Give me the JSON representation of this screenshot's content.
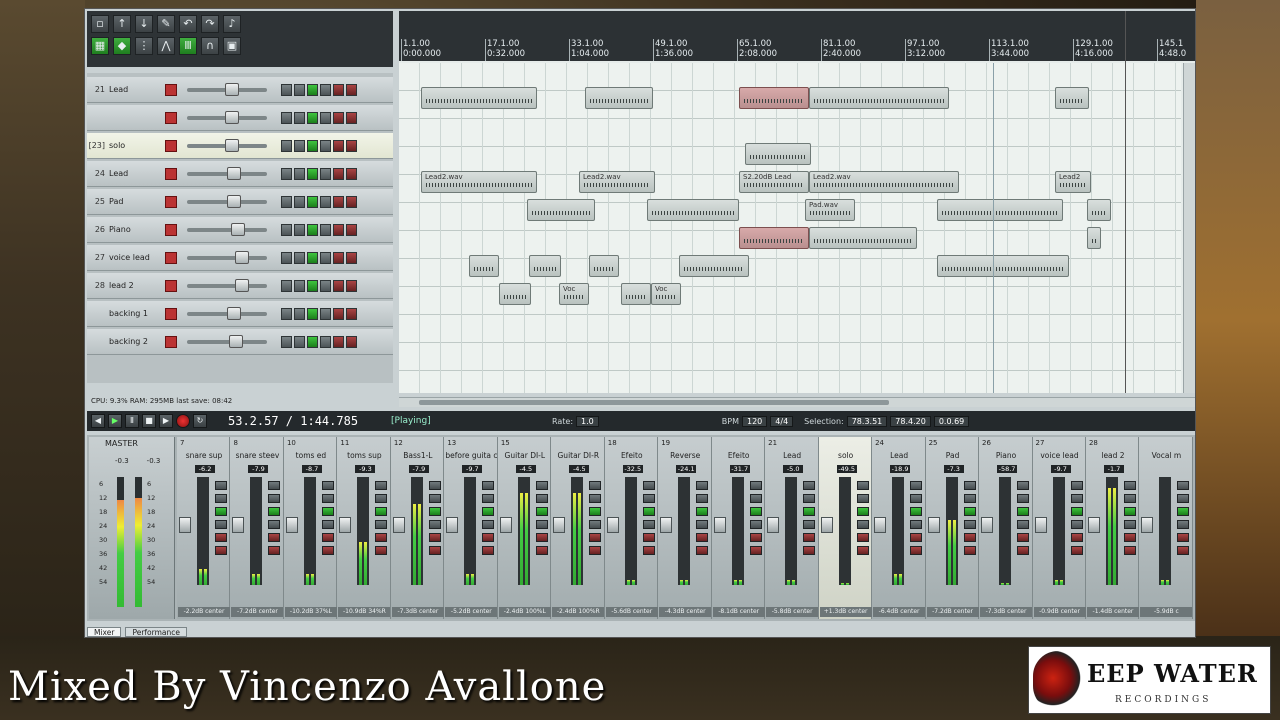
{
  "toolbar": {
    "row1": [
      "new-file",
      "open",
      "save",
      "render",
      "undo",
      "redo",
      "metronome"
    ],
    "row2": [
      "grid",
      "snap",
      "mixer",
      "trim",
      "midi",
      "loop",
      "lock"
    ]
  },
  "tracks": [
    {
      "num": "21",
      "name": "Lead"
    },
    {
      "num": "",
      "name": ""
    },
    {
      "num": "[23]",
      "name": "solo"
    },
    {
      "num": "24",
      "name": "Lead"
    },
    {
      "num": "25",
      "name": "Pad"
    },
    {
      "num": "26",
      "name": "Piano"
    },
    {
      "num": "27",
      "name": "voice lead"
    },
    {
      "num": "28",
      "name": "lead 2"
    },
    {
      "num": "",
      "name": "backing 1"
    },
    {
      "num": "",
      "name": "backing 2"
    }
  ],
  "status": "CPU: 9.3%  RAM: 295MB  last save: 08:42",
  "ruler": {
    "marks": [
      {
        "bar": "1.1.00",
        "time": "0:00.000"
      },
      {
        "bar": "17.1.00",
        "time": "0:32.000"
      },
      {
        "bar": "33.1.00",
        "time": "1:04.000"
      },
      {
        "bar": "49.1.00",
        "time": "1:36.000"
      },
      {
        "bar": "65.1.00",
        "time": "2:08.000"
      },
      {
        "bar": "81.1.00",
        "time": "2:40.000"
      },
      {
        "bar": "97.1.00",
        "time": "3:12.000"
      },
      {
        "bar": "113.1.00",
        "time": "3:44.000"
      },
      {
        "bar": "129.1.00",
        "time": "4:16.000"
      },
      {
        "bar": "145.1",
        "time": "4:48.0"
      }
    ]
  },
  "items": [
    {
      "label": "Lead2.wav",
      "lane": 3
    },
    {
      "label": "Lead2.wav",
      "lane": 3
    },
    {
      "label": "S2.20dB Lead",
      "lane": 3
    },
    {
      "label": "Lead2.wav",
      "lane": 3
    },
    {
      "label": "Lead2",
      "lane": 3
    },
    {
      "label": "Pad.wav",
      "lane": 4
    },
    {
      "label": "Voc",
      "lane": 7
    },
    {
      "label": "Voc",
      "lane": 7
    }
  ],
  "transport": {
    "time": "53.2.57 / 1:44.785",
    "state": "[Playing]",
    "rate_label": "Rate:",
    "rate": "1.0",
    "bpm_label": "BPM",
    "bpm": "120",
    "sig": "4/4",
    "selection_label": "Selection:",
    "sel_start": "78.3.51",
    "sel_end": "78.4.20",
    "sel_len": "0.0.69"
  },
  "master": {
    "label": "MASTER",
    "left_db": "-0.3",
    "right_db": "-0.3",
    "scale": [
      "6",
      "12",
      "18",
      "24",
      "30",
      "36",
      "42",
      "54"
    ],
    "level_left": 0.82,
    "level_right": 0.84
  },
  "channels": [
    {
      "num": "7",
      "name": "snare sup",
      "db": "-6.2",
      "pan": "-2.2dB center",
      "level": 0.15
    },
    {
      "num": "8",
      "name": "snare steev",
      "db": "-7.9",
      "pan": "-7.2dB center",
      "level": 0.1
    },
    {
      "num": "10",
      "name": "toms ed",
      "db": "-8.7",
      "pan": "-10.2dB 37%L",
      "level": 0.1
    },
    {
      "num": "11",
      "name": "toms sup",
      "db": "-9.3",
      "pan": "-10.9dB 34%R",
      "level": 0.4
    },
    {
      "num": "12",
      "name": "Bass1-L",
      "db": "-7.9",
      "pan": "-7.3dB center",
      "level": 0.75
    },
    {
      "num": "13",
      "name": "before guita c",
      "db": "-9.7",
      "pan": "-5.2dB center",
      "level": 0.1
    },
    {
      "num": "15",
      "name": "Guitar DI-L",
      "db": "-4.5",
      "pan": "-2.4dB 100%L",
      "level": 0.85
    },
    {
      "num": "",
      "name": "Guitar DI-R",
      "db": "-4.5",
      "pan": "-2.4dB 100%R",
      "level": 0.85
    },
    {
      "num": "18",
      "name": "Efeito",
      "db": "-32.5",
      "pan": "-5.6dB center",
      "level": 0.05
    },
    {
      "num": "19",
      "name": "Reverse",
      "db": "-24.1",
      "pan": "-4.3dB center",
      "level": 0.05
    },
    {
      "num": "",
      "name": "Efeito",
      "db": "-31.7",
      "pan": "-8.1dB center",
      "level": 0.05
    },
    {
      "num": "21",
      "name": "Lead",
      "db": "-5.0",
      "pan": "-5.8dB center",
      "level": 0.05
    },
    {
      "num": "",
      "name": "solo",
      "db": "-49.5",
      "pan": "+1.3dB center",
      "level": 0.02
    },
    {
      "num": "24",
      "name": "Lead",
      "db": "-18.9",
      "pan": "-6.4dB center",
      "level": 0.1
    },
    {
      "num": "25",
      "name": "Pad",
      "db": "-7.3",
      "pan": "-7.2dB center",
      "level": 0.6
    },
    {
      "num": "26",
      "name": "Piano",
      "db": "-58.7",
      "pan": "-7.3dB center",
      "level": 0.02
    },
    {
      "num": "27",
      "name": "voice lead",
      "db": "-9.7",
      "pan": "-0.9dB center",
      "level": 0.05
    },
    {
      "num": "28",
      "name": "lead 2",
      "db": "-1.7",
      "pan": "-1.4dB center",
      "level": 0.9
    },
    {
      "num": "",
      "name": "Vocal m",
      "db": "",
      "pan": "-5.9dB c",
      "level": 0.05
    }
  ],
  "tabs": [
    "Mixer",
    "Performance"
  ],
  "caption": "Mixed By Vincenzo Avallone",
  "logo": {
    "title": "EEP WATER",
    "sub": "RECORDINGS"
  }
}
